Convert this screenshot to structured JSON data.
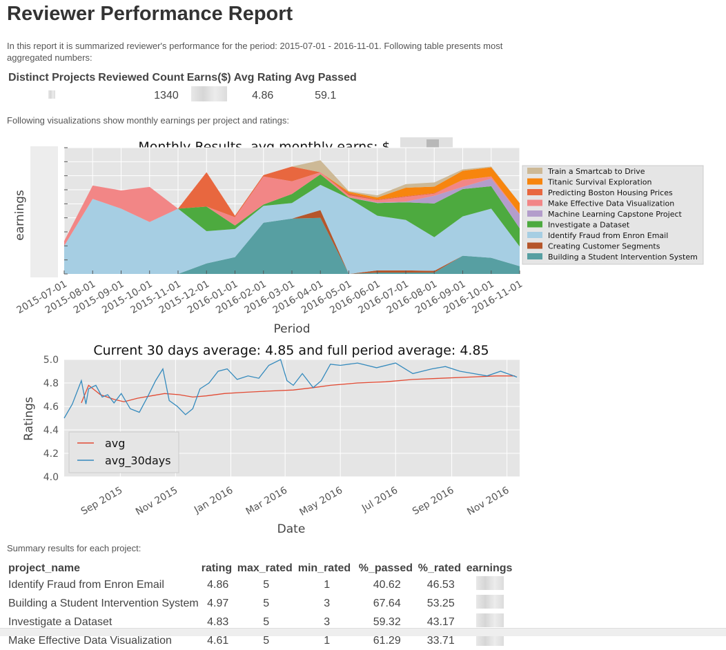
{
  "report": {
    "title": "Reviewer Performance Report",
    "intro": "In this report it is summarized reviewer's performance for the period: 2015-07-01 - 2016-11-01. Following table presents most aggregated numbers:",
    "viz_intro": "Following visualizations show monthly earnings per project and ratings:",
    "summary_intro": "Summary results for each project:"
  },
  "aggregate": {
    "headers": [
      "Distinct Projects",
      "Reviewed Count",
      "Earns($)",
      "Avg Rating",
      "Avg Passed"
    ],
    "reviewed_count": "1340",
    "avg_rating": "4.86",
    "avg_passed": "59.1"
  },
  "monthly_chart": {
    "title": "Monthly Results, avg monthly earns: $",
    "xlabel": "Period",
    "ylabel": "earnings",
    "periods": [
      "2015-07-01",
      "2015-08-01",
      "2015-09-01",
      "2015-10-01",
      "2015-11-01",
      "2015-12-01",
      "2016-01-01",
      "2016-02-01",
      "2016-03-01",
      "2016-04-01",
      "2016-05-01",
      "2016-06-01",
      "2016-07-01",
      "2016-08-01",
      "2016-09-01",
      "2016-10-01",
      "2016-11-01"
    ],
    "legend": [
      "Train a Smartcab to Drive",
      "Titanic Survival Exploration",
      "Predicting Boston Housing Prices",
      "Make Effective Data Visualization",
      "Machine Learning Capstone Project",
      "Investigate a Dataset",
      "Identify Fraud from Enron Email",
      "Creating Customer Segments",
      "Building a Student Intervention System"
    ],
    "colors": {
      "Train a Smartcab to Drive": "#CDB996",
      "Titanic Survival Exploration": "#F7850E",
      "Predicting Boston Housing Prices": "#E8673F",
      "Make Effective Data Visualization": "#F28686",
      "Machine Learning Capstone Project": "#B39DCB",
      "Investigate a Dataset": "#4DAA3F",
      "Identify Fraud from Enron Email": "#A6CEE3",
      "Creating Customer Segments": "#B5562B",
      "Building a Student Intervention System": "#579FA2"
    }
  },
  "ratings_chart": {
    "title": "Current 30 days average: 4.85 and full period average: 4.85",
    "xlabel": "Date",
    "ylabel": "Ratings",
    "y_ticks": [
      "4.0",
      "4.2",
      "4.4",
      "4.6",
      "4.8",
      "5.0"
    ],
    "x_ticks": [
      "Sep 2015",
      "Nov 2015",
      "Jan 2016",
      "Mar 2016",
      "May 2016",
      "Jul 2016",
      "Sep 2016",
      "Nov 2016"
    ],
    "legend": [
      "avg",
      "avg_30days"
    ],
    "colors": {
      "avg": "#E24A33",
      "avg_30days": "#348ABD"
    }
  },
  "chart_data": [
    {
      "type": "area",
      "title": "Monthly Results, avg monthly earns: $",
      "xlabel": "Period",
      "ylabel": "earnings",
      "categories": [
        "2015-07-01",
        "2015-08-01",
        "2015-09-01",
        "2015-10-01",
        "2015-11-01",
        "2015-12-01",
        "2016-01-01",
        "2016-02-01",
        "2016-03-01",
        "2016-04-01",
        "2016-05-01",
        "2016-06-01",
        "2016-07-01",
        "2016-08-01",
        "2016-09-01",
        "2016-10-01",
        "2016-11-01"
      ],
      "ylim": [
        0,
        9
      ],
      "stacked": true,
      "series": [
        {
          "name": "Building a Student Intervention System",
          "values": [
            0,
            0,
            0,
            0,
            0,
            0.75,
            1.2,
            3.65,
            3.95,
            4.0,
            0,
            0.1,
            0.1,
            0.1,
            1.3,
            1.15,
            0.55
          ]
        },
        {
          "name": "Creating Customer Segments",
          "values": [
            0,
            0,
            0,
            0,
            0,
            0,
            0,
            0,
            0,
            0.55,
            0,
            0.15,
            0.15,
            0.12,
            0,
            0,
            0
          ]
        },
        {
          "name": "Identify Fraud from Enron Email",
          "values": [
            2.0,
            5.35,
            4.65,
            3.7,
            4.65,
            2.3,
            2.0,
            1.2,
            1.1,
            1.8,
            5.4,
            3.9,
            3.6,
            2.4,
            2.8,
            3.5,
            1.4
          ]
        },
        {
          "name": "Investigate a Dataset",
          "values": [
            0,
            0,
            0,
            0,
            0,
            1.75,
            0.25,
            0.1,
            0.65,
            0.75,
            0.05,
            0.9,
            1.25,
            2.4,
            1.95,
            1.6,
            1.3
          ]
        },
        {
          "name": "Machine Learning Capstone Project",
          "values": [
            0,
            0,
            0,
            0,
            0,
            0,
            0,
            0,
            0,
            0,
            0,
            0.05,
            0.05,
            0.55,
            0.15,
            0.55,
            1.0
          ]
        },
        {
          "name": "Make Effective Data Visualization",
          "values": [
            0.35,
            0.95,
            1.3,
            2.5,
            0,
            0,
            0.6,
            2.0,
            0.9,
            0.15,
            0.15,
            0.15,
            0.35,
            0.15,
            0.5,
            0.15,
            0.05
          ]
        },
        {
          "name": "Predicting Boston Housing Prices",
          "values": [
            0,
            0,
            0,
            0,
            0,
            2.45,
            0.1,
            0.1,
            1.05,
            0,
            0.15,
            0.05,
            0.05,
            0.05,
            0,
            0,
            0
          ]
        },
        {
          "name": "Titanic Survival Exploration",
          "values": [
            0,
            0,
            0,
            0,
            0,
            0,
            0,
            0,
            0,
            0,
            0.1,
            0.15,
            0.6,
            0.45,
            0.65,
            0.65,
            0.75
          ]
        },
        {
          "name": "Train a Smartcab to Drive",
          "values": [
            0,
            0,
            0,
            0,
            0,
            0,
            0,
            0,
            0,
            0.85,
            0.05,
            0.15,
            0.25,
            0.3,
            0.1,
            0.05,
            0
          ]
        }
      ]
    },
    {
      "type": "line",
      "title": "Current 30 days average: 4.85 and full period average: 4.85",
      "xlabel": "Date",
      "ylabel": "Ratings",
      "ylim": [
        4.0,
        5.0
      ],
      "x_range": [
        "2015-07-01",
        "2016-11-15"
      ],
      "series": [
        {
          "name": "avg",
          "x": [
            "2015-07-20",
            "2015-07-28",
            "2015-08-10",
            "2015-08-25",
            "2015-09-05",
            "2015-09-20",
            "2015-10-05",
            "2015-10-20",
            "2015-11-05",
            "2015-11-20",
            "2015-12-05",
            "2015-12-25",
            "2016-01-15",
            "2016-02-10",
            "2016-03-10",
            "2016-04-01",
            "2016-04-20",
            "2016-05-20",
            "2016-06-20",
            "2016-07-20",
            "2016-08-20",
            "2016-09-20",
            "2016-10-20",
            "2016-11-10"
          ],
          "values": [
            4.63,
            4.78,
            4.7,
            4.66,
            4.64,
            4.67,
            4.69,
            4.71,
            4.7,
            4.68,
            4.69,
            4.71,
            4.72,
            4.73,
            4.74,
            4.76,
            4.78,
            4.8,
            4.81,
            4.83,
            4.84,
            4.85,
            4.86,
            4.86
          ]
        },
        {
          "name": "avg_30days",
          "x": [
            "2015-07-01",
            "2015-07-10",
            "2015-07-20",
            "2015-07-25",
            "2015-07-28",
            "2015-08-05",
            "2015-08-12",
            "2015-08-18",
            "2015-08-25",
            "2015-09-02",
            "2015-09-12",
            "2015-09-22",
            "2015-10-01",
            "2015-10-10",
            "2015-10-18",
            "2015-10-25",
            "2015-11-03",
            "2015-11-12",
            "2015-11-20",
            "2015-11-28",
            "2015-12-08",
            "2015-12-18",
            "2015-12-28",
            "2016-01-08",
            "2016-01-20",
            "2016-02-01",
            "2016-02-12",
            "2016-02-25",
            "2016-03-03",
            "2016-03-10",
            "2016-03-20",
            "2016-04-01",
            "2016-04-10",
            "2016-04-20",
            "2016-05-01",
            "2016-05-20",
            "2016-06-10",
            "2016-07-01",
            "2016-07-20",
            "2016-08-10",
            "2016-08-25",
            "2016-09-10",
            "2016-09-25",
            "2016-10-10",
            "2016-10-25",
            "2016-11-05",
            "2016-11-12"
          ],
          "values": [
            4.5,
            4.62,
            4.82,
            4.62,
            4.75,
            4.78,
            4.68,
            4.7,
            4.63,
            4.71,
            4.58,
            4.55,
            4.68,
            4.82,
            4.92,
            4.65,
            4.6,
            4.53,
            4.58,
            4.75,
            4.8,
            4.9,
            4.92,
            4.83,
            4.86,
            4.84,
            4.95,
            5.0,
            4.82,
            4.78,
            4.88,
            4.76,
            4.82,
            4.96,
            4.95,
            4.97,
            4.93,
            4.97,
            4.88,
            4.92,
            4.94,
            4.9,
            4.88,
            4.86,
            4.9,
            4.87,
            4.85
          ]
        }
      ]
    }
  ],
  "projects_table": {
    "headers": [
      "project_name",
      "rating",
      "max_rated",
      "min_rated",
      "%_passed",
      "%_rated",
      "earnings"
    ],
    "rows": [
      [
        "Identify Fraud from Enron Email",
        "4.86",
        "5",
        "1",
        "40.62",
        "46.53"
      ],
      [
        "Building a Student Intervention System",
        "4.97",
        "5",
        "3",
        "67.64",
        "53.25"
      ],
      [
        "Investigate a Dataset",
        "4.83",
        "5",
        "3",
        "59.32",
        "43.17"
      ],
      [
        "Make Effective Data Visualization",
        "4.61",
        "5",
        "1",
        "61.29",
        "33.71"
      ]
    ]
  }
}
